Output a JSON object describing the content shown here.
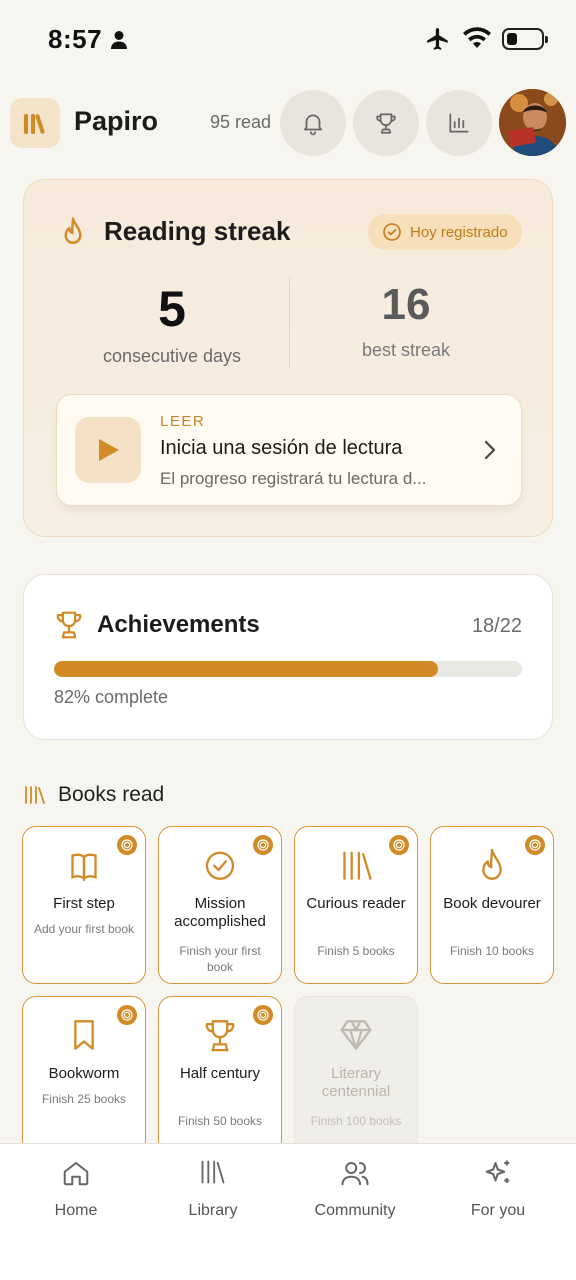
{
  "status": {
    "time": "8:57"
  },
  "header": {
    "app_name": "Papiro",
    "read_count": "95 read"
  },
  "streak": {
    "title": "Reading streak",
    "badge": "Hoy registrado",
    "current": "5",
    "current_label": "consecutive days",
    "best": "16",
    "best_label": "best streak",
    "session": {
      "kicker": "LEER",
      "title": "Inicia una sesión de lectura",
      "subtitle": "El progreso registrará tu lectura d..."
    }
  },
  "achievements": {
    "title": "Achievements",
    "count": "18/22",
    "progress": 0.82,
    "complete_label": "82% complete"
  },
  "books_section": {
    "title": "Books read"
  },
  "badges": [
    {
      "name": "First step",
      "desc": "Add your first book",
      "icon": "open-book-icon",
      "unlocked": true
    },
    {
      "name": "Mission accomplished",
      "desc": "Finish your first book",
      "icon": "check-circle-icon",
      "unlocked": true
    },
    {
      "name": "Curious reader",
      "desc": "Finish 5 books",
      "icon": "library-icon",
      "unlocked": true
    },
    {
      "name": "Book devourer",
      "desc": "Finish 10 books",
      "icon": "flame-icon",
      "unlocked": true
    },
    {
      "name": "Bookworm",
      "desc": "Finish 25 books",
      "icon": "bookmark-icon",
      "unlocked": true
    },
    {
      "name": "Half century",
      "desc": "Finish 50 books",
      "icon": "trophy-icon",
      "unlocked": true
    },
    {
      "name": "Literary centennial",
      "desc": "Finish 100 books",
      "icon": "diamond-icon",
      "unlocked": false
    }
  ],
  "nav": {
    "home": "Home",
    "library": "Library",
    "community": "Community",
    "for_you": "For you"
  },
  "colors": {
    "accent": "#d18a25",
    "background": "#f7f5f0"
  }
}
